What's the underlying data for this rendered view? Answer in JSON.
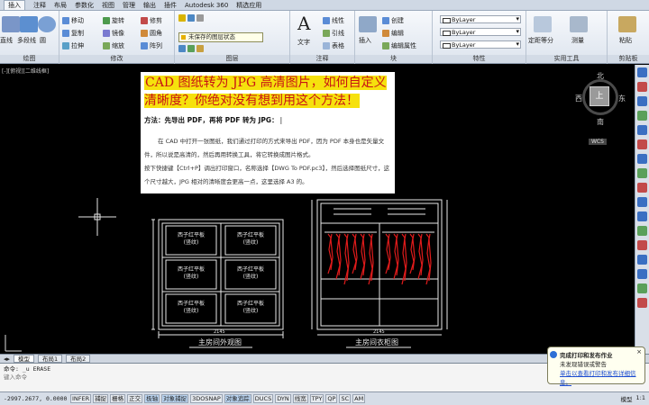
{
  "app": {
    "product_name": "Autodesk 360",
    "tabs": [
      "插入",
      "注释",
      "布局",
      "参数化",
      "视图",
      "管理",
      "输出",
      "插件",
      "Autodesk 360",
      "精选应用"
    ],
    "active_tab": "插入"
  },
  "ribbon": {
    "draw": {
      "line": "直线",
      "polyline": "多段线",
      "circle": "圆",
      "arc": "圆弧",
      "label": "绘图"
    },
    "modify": {
      "move": "移动",
      "rotate": "旋转",
      "trim": "修剪",
      "copy": "复制",
      "mirror": "镜像",
      "fillet": "圆角",
      "stretch": "拉伸",
      "scale": "缩放",
      "array": "阵列",
      "label": "修改"
    },
    "layers": {
      "unsaved_state": "未保存的图层状态",
      "label": "图层"
    },
    "annotation": {
      "text": "文字",
      "linear": "线性",
      "leader": "引线",
      "table": "表格",
      "label": "注释"
    },
    "block": {
      "insert": "插入",
      "create": "创建",
      "edit": "编辑",
      "edit_attributes": "编辑属性",
      "label": "块"
    },
    "properties": {
      "color": "ByLayer",
      "linetype": "ByLayer",
      "lineweight": "ByLayer",
      "label": "特性"
    },
    "utilities": {
      "measure": "测量",
      "quick_select": "定距等分",
      "label": "实用工具"
    },
    "clipboard": {
      "paste": "粘贴",
      "label": "剪贴板"
    }
  },
  "viewport": {
    "label": "[-][俯视][二维线框]"
  },
  "article": {
    "title": "CAD 图纸转为 JPG 高清图片，如何自定义清晰度？你绝对没有想到用这个方法！",
    "method": "方法：先导出 PDF，再将 PDF 转为 JPG：",
    "paragraph1": "在 CAD 中打开一张图纸，我们通过打印的方式来导出 PDF，因为 PDF 本身也是矢量文件，所以说是高清的，然后再用转换工具，将它转换成图片格式。",
    "paragraph2": "按下快捷键【Ctrl+P】调出打印窗口，名称选择【DWG To PDF.pc3】，然后选择图纸尺寸，这个尺寸越大，JPG 相对的清晰度会更高一点，这里选择 A3 的。"
  },
  "drawing": {
    "panel_label": "西子红平板\n(竖纹)",
    "caption_exterior": "主房间外观图",
    "caption_cabinet": "主房间衣柜图",
    "dim_bottom": "2145"
  },
  "viewcube": {
    "north": "北",
    "south": "南",
    "east": "东",
    "west": "西",
    "top": "上",
    "wcs": "WCS"
  },
  "layout_tabs": [
    "模型",
    "布局1",
    "布局2"
  ],
  "command_line": {
    "history": "命令: _u ERASE",
    "prompt": "键入命令"
  },
  "statusbar": {
    "coords": "-2997.2677, 0.0000",
    "toggles": [
      "INFER",
      "捕捉",
      "栅格",
      "正交",
      "极轴",
      "对象捕捉",
      "3DOSNAP",
      "对象追踪",
      "DUCS",
      "DYN",
      "线宽",
      "TPY",
      "QP",
      "SC",
      "AM"
    ],
    "model": "模型",
    "scale": "1:1"
  },
  "notification": {
    "title": "完成打印和发布作业",
    "subtitle": "未发现错误或警告",
    "link": "单击以查看打印和发布详细信息。",
    "close": "×"
  },
  "colors": {
    "drawing_lines": "#e8e8e8",
    "red_marks": "#e01b1b",
    "highlight": "#f6e10d"
  }
}
